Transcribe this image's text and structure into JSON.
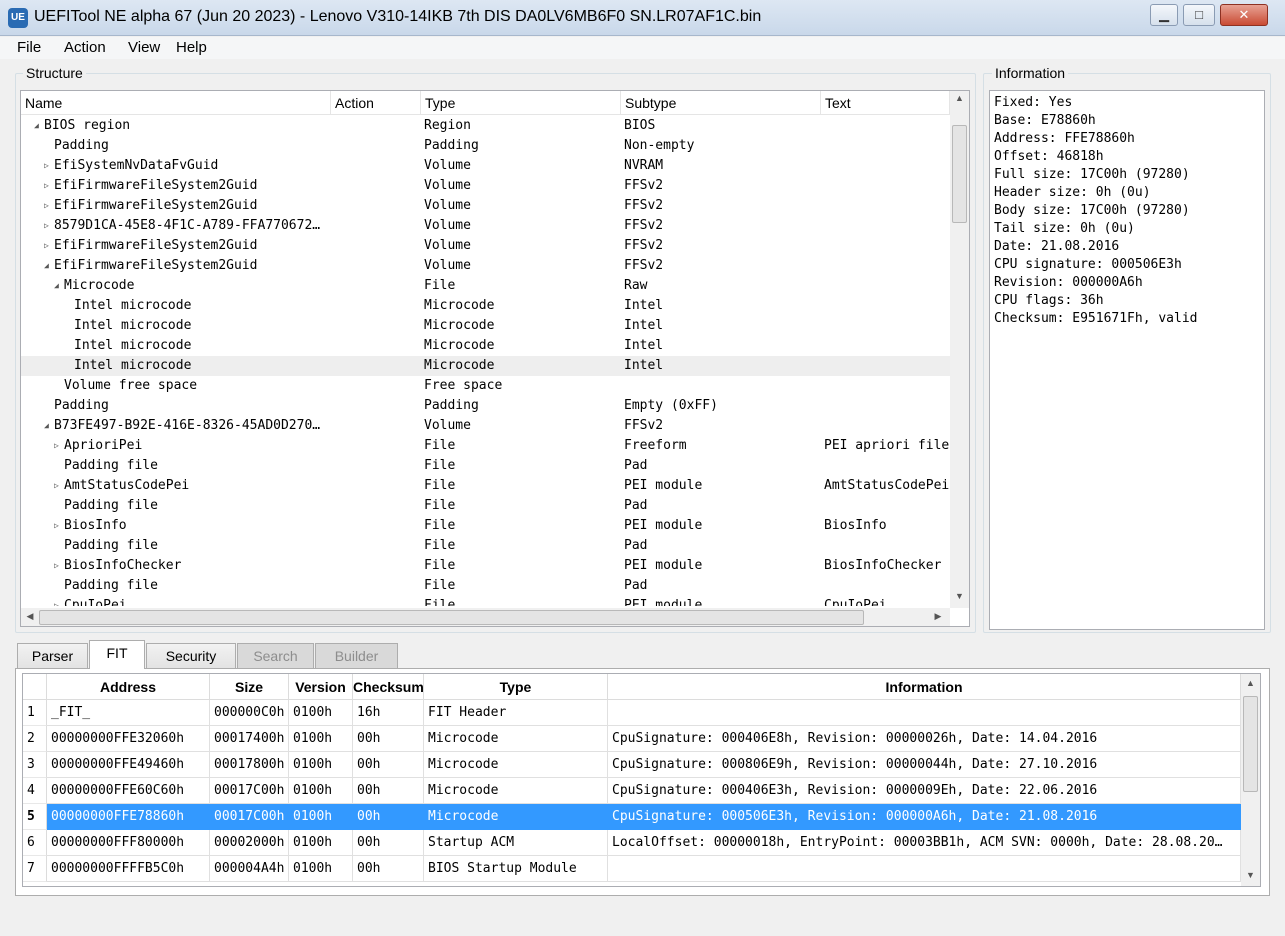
{
  "window": {
    "title": "UEFITool NE alpha 67 (Jun 20 2023) - Lenovo V310-14IKB 7th DIS  DA0LV6MB6F0  SN.LR07AF1C.bin",
    "icon_text": "UE",
    "minimize": "▁",
    "maximize": "□",
    "close": "✕"
  },
  "menu": [
    "File",
    "Action",
    "View",
    "Help"
  ],
  "structure": {
    "title": "Structure",
    "columns": [
      "Name",
      "Action",
      "Type",
      "Subtype",
      "Text"
    ],
    "rows": [
      {
        "indent": 1,
        "arrow": "◢",
        "name": "BIOS region",
        "type": "Region",
        "subtype": "BIOS",
        "text": ""
      },
      {
        "indent": 2,
        "arrow": "",
        "name": "Padding",
        "type": "Padding",
        "subtype": "Non-empty",
        "text": ""
      },
      {
        "indent": 2,
        "arrow": "▷",
        "name": "EfiSystemNvDataFvGuid",
        "type": "Volume",
        "subtype": "NVRAM",
        "text": ""
      },
      {
        "indent": 2,
        "arrow": "▷",
        "name": "EfiFirmwareFileSystem2Guid",
        "type": "Volume",
        "subtype": "FFSv2",
        "text": ""
      },
      {
        "indent": 2,
        "arrow": "▷",
        "name": "EfiFirmwareFileSystem2Guid",
        "type": "Volume",
        "subtype": "FFSv2",
        "text": ""
      },
      {
        "indent": 2,
        "arrow": "▷",
        "name": "8579D1CA-45E8-4F1C-A789-FFA770672…",
        "type": "Volume",
        "subtype": "FFSv2",
        "text": ""
      },
      {
        "indent": 2,
        "arrow": "▷",
        "name": "EfiFirmwareFileSystem2Guid",
        "type": "Volume",
        "subtype": "FFSv2",
        "text": ""
      },
      {
        "indent": 2,
        "arrow": "◢",
        "name": "EfiFirmwareFileSystem2Guid",
        "type": "Volume",
        "subtype": "FFSv2",
        "text": ""
      },
      {
        "indent": 3,
        "arrow": "◢",
        "name": "Microcode",
        "type": "File",
        "subtype": "Raw",
        "text": ""
      },
      {
        "indent": 4,
        "arrow": "",
        "name": "Intel microcode",
        "type": "Microcode",
        "subtype": "Intel",
        "text": ""
      },
      {
        "indent": 4,
        "arrow": "",
        "name": "Intel microcode",
        "type": "Microcode",
        "subtype": "Intel",
        "text": ""
      },
      {
        "indent": 4,
        "arrow": "",
        "name": "Intel microcode",
        "type": "Microcode",
        "subtype": "Intel",
        "text": ""
      },
      {
        "indent": 4,
        "arrow": "",
        "name": "Intel microcode",
        "type": "Microcode",
        "subtype": "Intel",
        "text": "",
        "selected": true
      },
      {
        "indent": 3,
        "arrow": "",
        "name": "Volume free space",
        "type": "Free space",
        "subtype": "",
        "text": ""
      },
      {
        "indent": 2,
        "arrow": "",
        "name": "Padding",
        "type": "Padding",
        "subtype": "Empty (0xFF)",
        "text": ""
      },
      {
        "indent": 2,
        "arrow": "◢",
        "name": "B73FE497-B92E-416E-8326-45AD0D270…",
        "type": "Volume",
        "subtype": "FFSv2",
        "text": ""
      },
      {
        "indent": 3,
        "arrow": "▷",
        "name": "AprioriPei",
        "type": "File",
        "subtype": "Freeform",
        "text": "PEI apriori file"
      },
      {
        "indent": 3,
        "arrow": "",
        "name": "Padding file",
        "type": "File",
        "subtype": "Pad",
        "text": ""
      },
      {
        "indent": 3,
        "arrow": "▷",
        "name": "AmtStatusCodePei",
        "type": "File",
        "subtype": "PEI module",
        "text": "AmtStatusCodePei"
      },
      {
        "indent": 3,
        "arrow": "",
        "name": "Padding file",
        "type": "File",
        "subtype": "Pad",
        "text": ""
      },
      {
        "indent": 3,
        "arrow": "▷",
        "name": "BiosInfo",
        "type": "File",
        "subtype": "PEI module",
        "text": "BiosInfo"
      },
      {
        "indent": 3,
        "arrow": "",
        "name": "Padding file",
        "type": "File",
        "subtype": "Pad",
        "text": ""
      },
      {
        "indent": 3,
        "arrow": "▷",
        "name": "BiosInfoChecker",
        "type": "File",
        "subtype": "PEI module",
        "text": "BiosInfoChecker"
      },
      {
        "indent": 3,
        "arrow": "",
        "name": "Padding file",
        "type": "File",
        "subtype": "Pad",
        "text": ""
      },
      {
        "indent": 3,
        "arrow": "▷",
        "name": "CpuIoPei",
        "type": "File",
        "subtype": "PEI module",
        "text": "CpuIoPei"
      }
    ]
  },
  "information": {
    "title": "Information",
    "lines": [
      "Fixed: Yes",
      "Base: E78860h",
      "Address: FFE78860h",
      "Offset: 46818h",
      "Full size: 17C00h (97280)",
      "Header size: 0h (0u)",
      "Body size: 17C00h (97280)",
      "Tail size: 0h (0u)",
      "Date: 21.08.2016",
      "CPU signature: 000506E3h",
      "Revision: 000000A6h",
      "CPU flags: 36h",
      "Checksum: E951671Fh, valid"
    ]
  },
  "tabs": [
    {
      "label": "Parser",
      "state": "normal"
    },
    {
      "label": "FIT",
      "state": "active"
    },
    {
      "label": "Security",
      "state": "normal"
    },
    {
      "label": "Search",
      "state": "disabled"
    },
    {
      "label": "Builder",
      "state": "disabled"
    }
  ],
  "fit": {
    "columns": [
      "Address",
      "Size",
      "Version",
      "Checksum",
      "Type",
      "Information"
    ],
    "rows": [
      {
        "n": "1",
        "address": "_FIT_",
        "size": "000000C0h",
        "version": "0100h",
        "checksum": "16h",
        "type": "FIT Header",
        "info": ""
      },
      {
        "n": "2",
        "address": "00000000FFE32060h",
        "size": "00017400h",
        "version": "0100h",
        "checksum": "00h",
        "type": "Microcode",
        "info": "CpuSignature: 000406E8h, Revision: 00000026h, Date: 14.04.2016"
      },
      {
        "n": "3",
        "address": "00000000FFE49460h",
        "size": "00017800h",
        "version": "0100h",
        "checksum": "00h",
        "type": "Microcode",
        "info": "CpuSignature: 000806E9h, Revision: 00000044h, Date: 27.10.2016"
      },
      {
        "n": "4",
        "address": "00000000FFE60C60h",
        "size": "00017C00h",
        "version": "0100h",
        "checksum": "00h",
        "type": "Microcode",
        "info": "CpuSignature: 000406E3h, Revision: 0000009Eh, Date: 22.06.2016"
      },
      {
        "n": "5",
        "address": "00000000FFE78860h",
        "size": "00017C00h",
        "version": "0100h",
        "checksum": "00h",
        "type": "Microcode",
        "info": "CpuSignature: 000506E3h, Revision: 000000A6h, Date: 21.08.2016",
        "selected": true
      },
      {
        "n": "6",
        "address": "00000000FFF80000h",
        "size": "00002000h",
        "version": "0100h",
        "checksum": "00h",
        "type": "Startup ACM",
        "info": "LocalOffset: 00000018h, EntryPoint: 00003BB1h, ACM SVN: 0000h, Date: 28.08.20…"
      },
      {
        "n": "7",
        "address": "00000000FFFFB5C0h",
        "size": "000004A4h",
        "version": "0100h",
        "checksum": "00h",
        "type": "BIOS Startup Module",
        "info": ""
      }
    ]
  },
  "colors": {
    "selection": "#3399ff",
    "tree_selection": "#eeeeee"
  }
}
